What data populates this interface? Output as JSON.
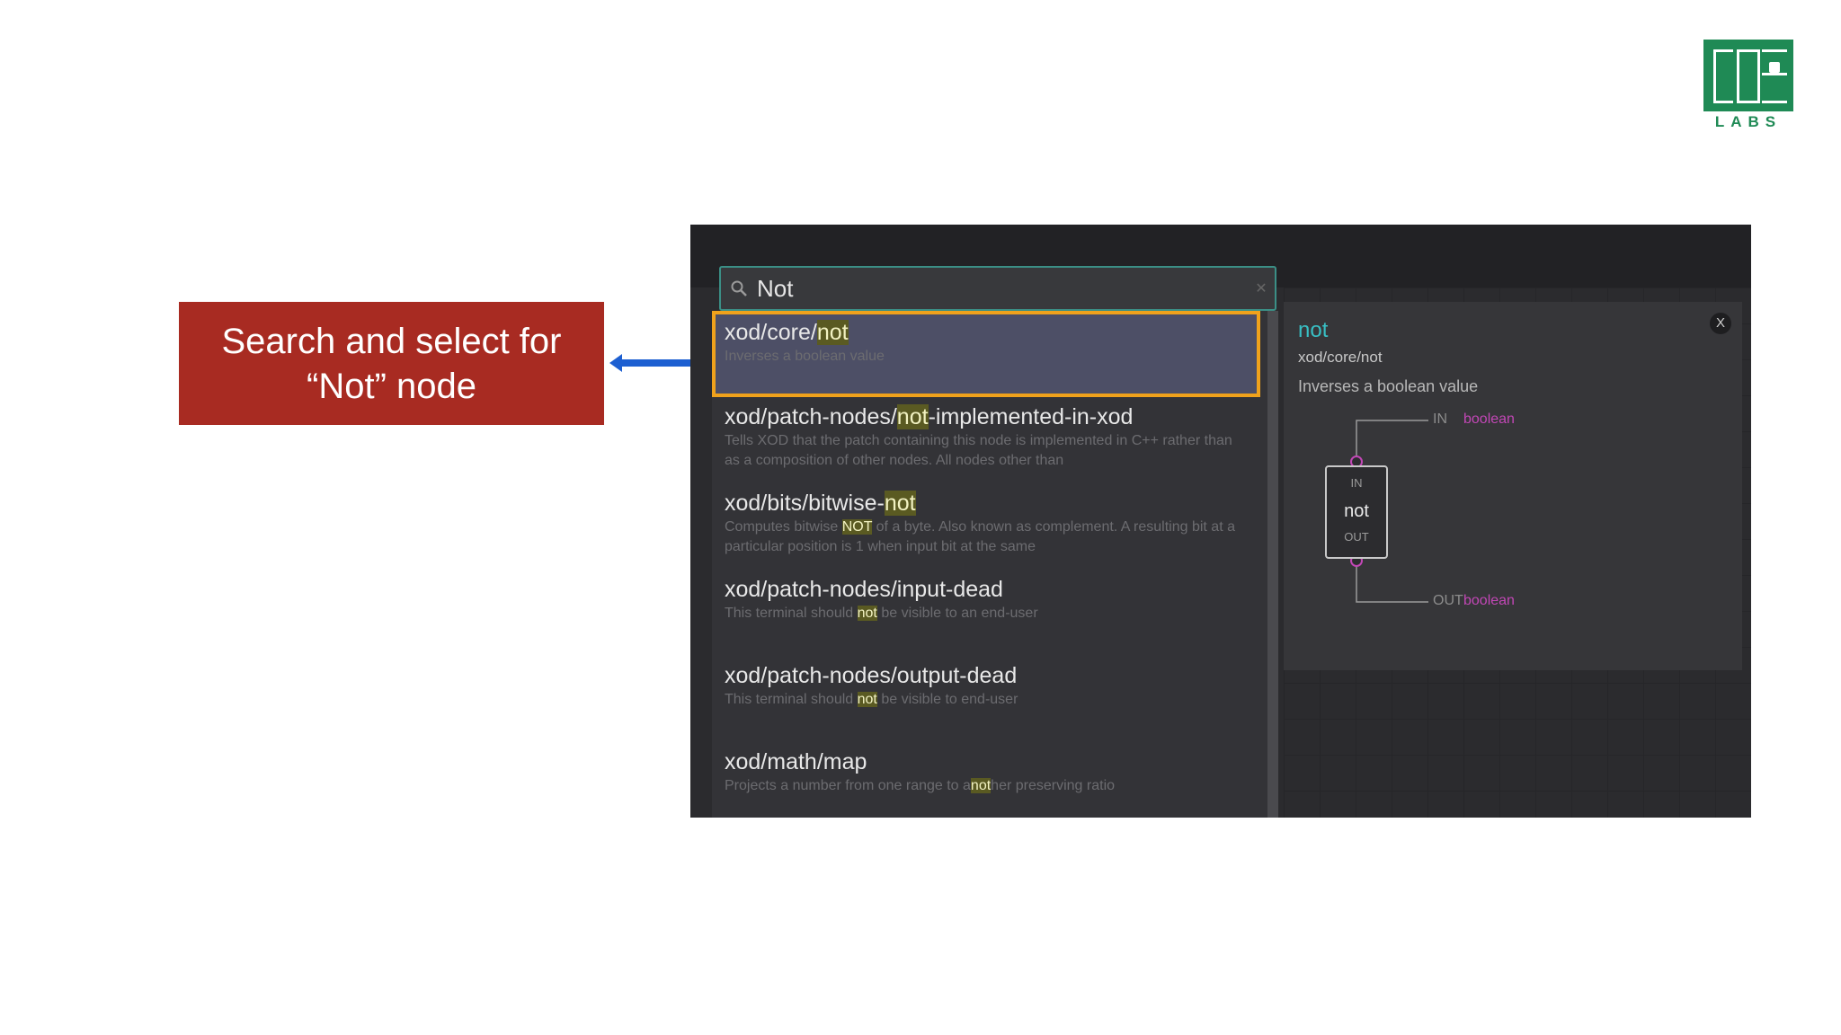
{
  "logo": {
    "text": "LABS"
  },
  "callout": {
    "line1": "Search and select for",
    "line2": "“Not” node"
  },
  "colors": {
    "callout_bg": "#a82b22",
    "arrow": "#1d5fd1",
    "selection_border": "#f0a21c",
    "search_border": "#3b8f86",
    "node_name": "#38bfc4",
    "pin_type": "#c247b6",
    "logo_green": "#1f8a55"
  },
  "search": {
    "value": "Not",
    "icon": "search-icon"
  },
  "results": [
    {
      "pre": "xod/core/",
      "hl": "not",
      "post": "",
      "desc": "Inverses a boolean value",
      "desc_pre": "",
      "desc_hl": "",
      "desc_post": ""
    },
    {
      "pre": "xod/patch-nodes/",
      "hl": "not",
      "post": "-implemented-in-xod",
      "desc_pre": "Tells XOD that the patch containing this node is implemented in C++ rather than as a composition of other nodes. All nodes other than",
      "desc_hl": "",
      "desc_post": ""
    },
    {
      "pre": "xod/bits/bitwise-",
      "hl": "not",
      "post": "",
      "desc_pre": "Computes bitwise ",
      "desc_hl": "NOT",
      "desc_post": " of a byte. Also known as complement. A resulting bit at a particular position is 1 when input bit at the same"
    },
    {
      "pre": "xod/patch-nodes/input-dead",
      "hl": "",
      "post": "",
      "desc_pre": "This terminal should ",
      "desc_hl": "not",
      "desc_post": " be visible to an end-user"
    },
    {
      "pre": "xod/patch-nodes/output-dead",
      "hl": "",
      "post": "",
      "desc_pre": "This terminal should ",
      "desc_hl": "not",
      "desc_post": " be visible to end-user"
    },
    {
      "pre": "xod/math/map",
      "hl": "",
      "post": "",
      "desc_pre": "Projects a number from one range to a",
      "desc_hl": "not",
      "desc_post": "her preserving ratio"
    }
  ],
  "info": {
    "close": "X",
    "name": "not",
    "path": "xod/core/not",
    "description": "Inverses a boolean value",
    "input": {
      "label": "IN",
      "type": "boolean"
    },
    "output": {
      "label": "OUT",
      "type": "boolean"
    },
    "node": {
      "in": "IN",
      "name": "not",
      "out": "OUT"
    }
  }
}
